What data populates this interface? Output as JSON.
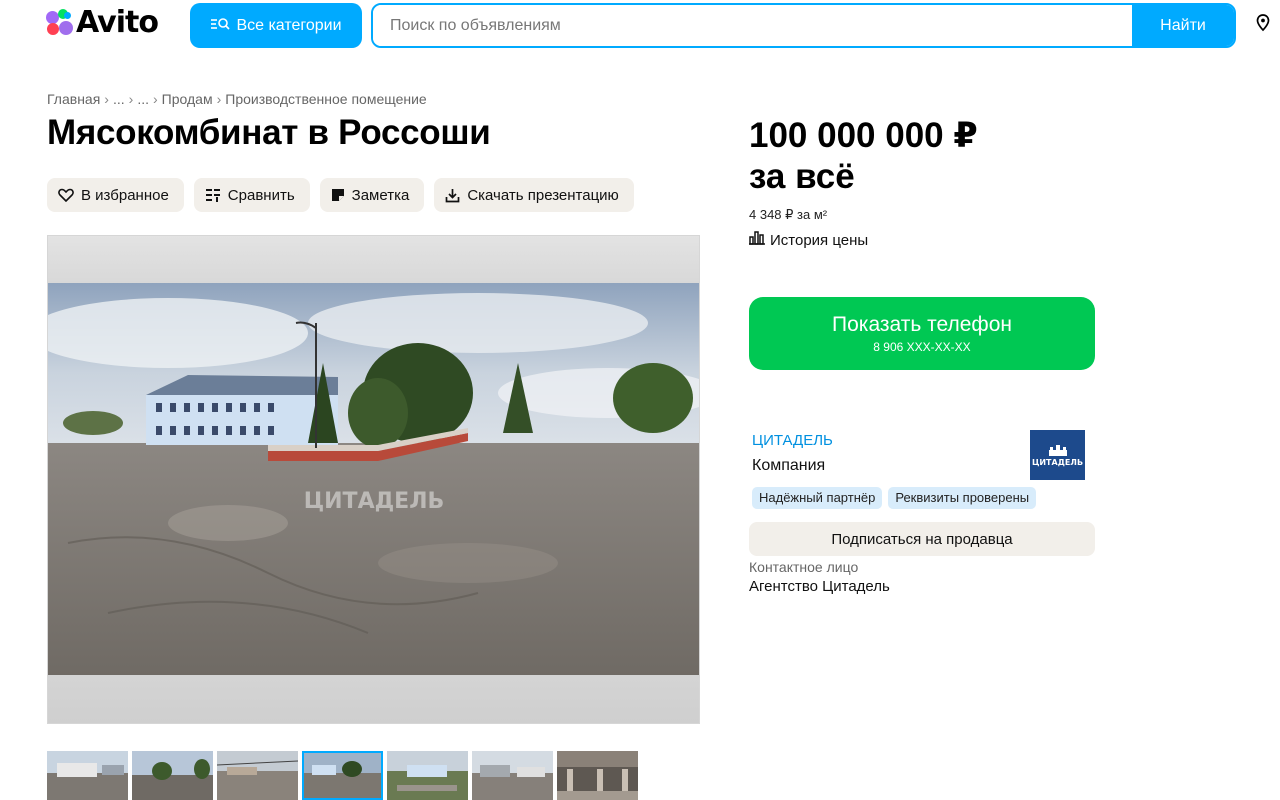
{
  "header": {
    "logo_text": "Avito",
    "categories_label": "Все категории",
    "search_placeholder": "Поиск по объявлениям",
    "search_button": "Найти",
    "brand_color": "#00aaff"
  },
  "breadcrumb": [
    "Главная",
    "...",
    "...",
    "Продам",
    "Производственное помещение"
  ],
  "listing": {
    "title": "Мясокомбинат в Россоши",
    "actions": [
      {
        "icon": "heart-icon",
        "label": "В избранное"
      },
      {
        "icon": "compare-icon",
        "label": "Сравнить"
      },
      {
        "icon": "note-icon",
        "label": "Заметка"
      },
      {
        "icon": "download-icon",
        "label": "Скачать презентацию"
      }
    ],
    "photo_watermark": "ЦИТАДЕЛЬ",
    "thumbnail_count": 7,
    "active_thumbnail_index": 3
  },
  "price": {
    "amount": "100 000 000 ₽",
    "suffix": "за всё",
    "per_sq_m": "4 348 ₽ за м²",
    "history_label": "История цены"
  },
  "phone": {
    "button_label": "Показать телефон",
    "masked_number": "8 906 XXX-XX-XX",
    "color": "#00c853"
  },
  "seller": {
    "name": "ЦИТАДЕЛЬ",
    "type": "Компания",
    "logo_text": "ЦИТАДЕЛЬ",
    "badges": [
      "Надёжный партнёр",
      "Реквизиты проверены"
    ],
    "subscribe_label": "Подписаться на продавца",
    "contact_label": "Контактное лицо",
    "contact_name": "Агентство Цитадель"
  }
}
